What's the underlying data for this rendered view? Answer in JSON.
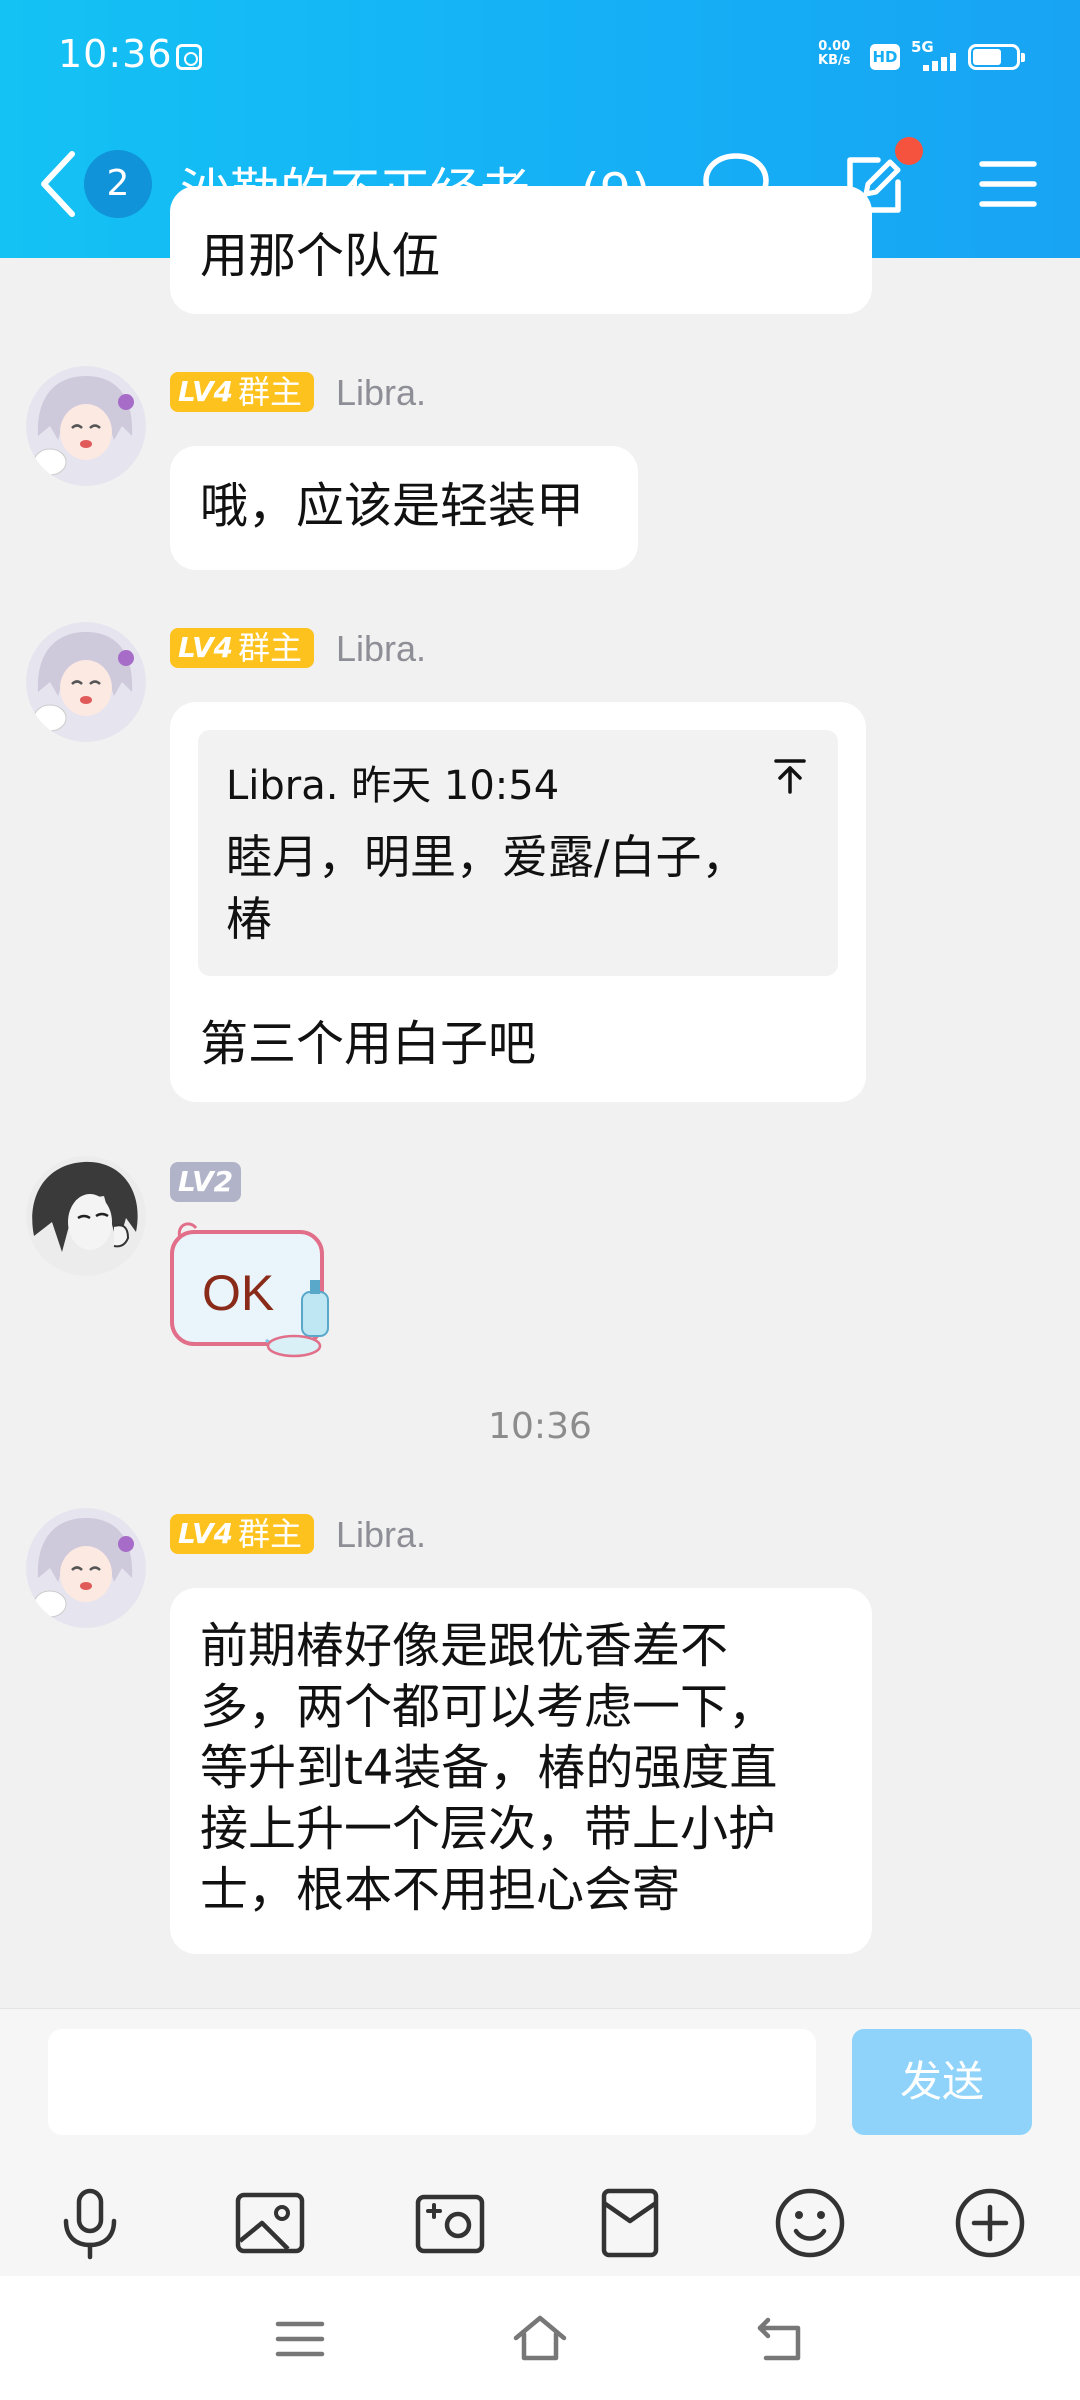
{
  "status_bar": {
    "time": "10:36",
    "net_speed_value": "0.00",
    "net_speed_unit": "KB/s",
    "hd": "HD",
    "network": "5G"
  },
  "header": {
    "unread_count": "2",
    "title": "沙勒的不正经老…(9)",
    "icons": [
      "back-icon",
      "chat-bubble-icon",
      "edit-icon",
      "menu-icon"
    ]
  },
  "messages": [
    {
      "type": "text",
      "partial": true,
      "text": "用那个队伍"
    },
    {
      "type": "text",
      "level": "LV4",
      "role": "群主",
      "sender": "Libra.",
      "text": "哦，应该是轻装甲"
    },
    {
      "type": "reply",
      "level": "LV4",
      "role": "群主",
      "sender": "Libra.",
      "quote": {
        "author_time": "Libra. 昨天 10:54",
        "line1": "睦月，明里，爱露/白子，",
        "line2": "椿"
      },
      "text": "第三个用白子吧"
    },
    {
      "type": "sticker",
      "level": "LV2",
      "sticker_text": "OK"
    },
    {
      "type": "time",
      "text": "10:36"
    },
    {
      "type": "text",
      "level": "LV4",
      "role": "群主",
      "sender": "Libra.",
      "lines": [
        "前期椿好像是跟优香差不",
        "多，两个都可以考虑一下，",
        "等升到t4装备，椿的强度直",
        "接上升一个层次，带上小护",
        "士，根本不用担心会寄"
      ]
    }
  ],
  "input": {
    "placeholder": "",
    "send_label": "发送",
    "tools": [
      "microphone-icon",
      "image-icon",
      "camera-icon",
      "red-packet-icon",
      "emoji-icon",
      "plus-icon"
    ]
  },
  "colors": {
    "header_start": "#14c2f4",
    "header_end": "#18a4f3",
    "lv4_badge": "#fdc21d",
    "lv2_badge": "#b1b3c9",
    "send_button": "#8fd3fb",
    "notify_dot": "#f5533d"
  }
}
